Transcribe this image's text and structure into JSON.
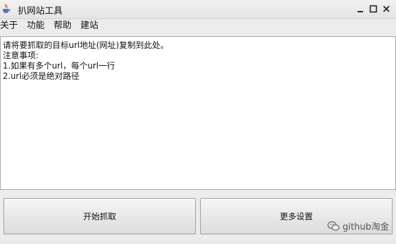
{
  "window": {
    "title": "扒网站工具",
    "icon": "java-cup-icon",
    "controls": [
      "minimize-icon",
      "maximize-icon",
      "close-icon"
    ]
  },
  "menu": {
    "items": [
      {
        "label": "关于"
      },
      {
        "label": "功能"
      },
      {
        "label": "帮助"
      },
      {
        "label": "建站"
      }
    ]
  },
  "editor": {
    "lines": [
      "请将要抓取的目标url地址(网址)复制到此处。",
      "注意事项:",
      "1.如果有多个url，每个url一行",
      "2.url必须是绝对路径"
    ]
  },
  "buttons": {
    "start_label": "开始抓取",
    "more_settings_label": "更多设置"
  },
  "watermark": {
    "text": "github淘金",
    "icon": "wechat-icon"
  }
}
